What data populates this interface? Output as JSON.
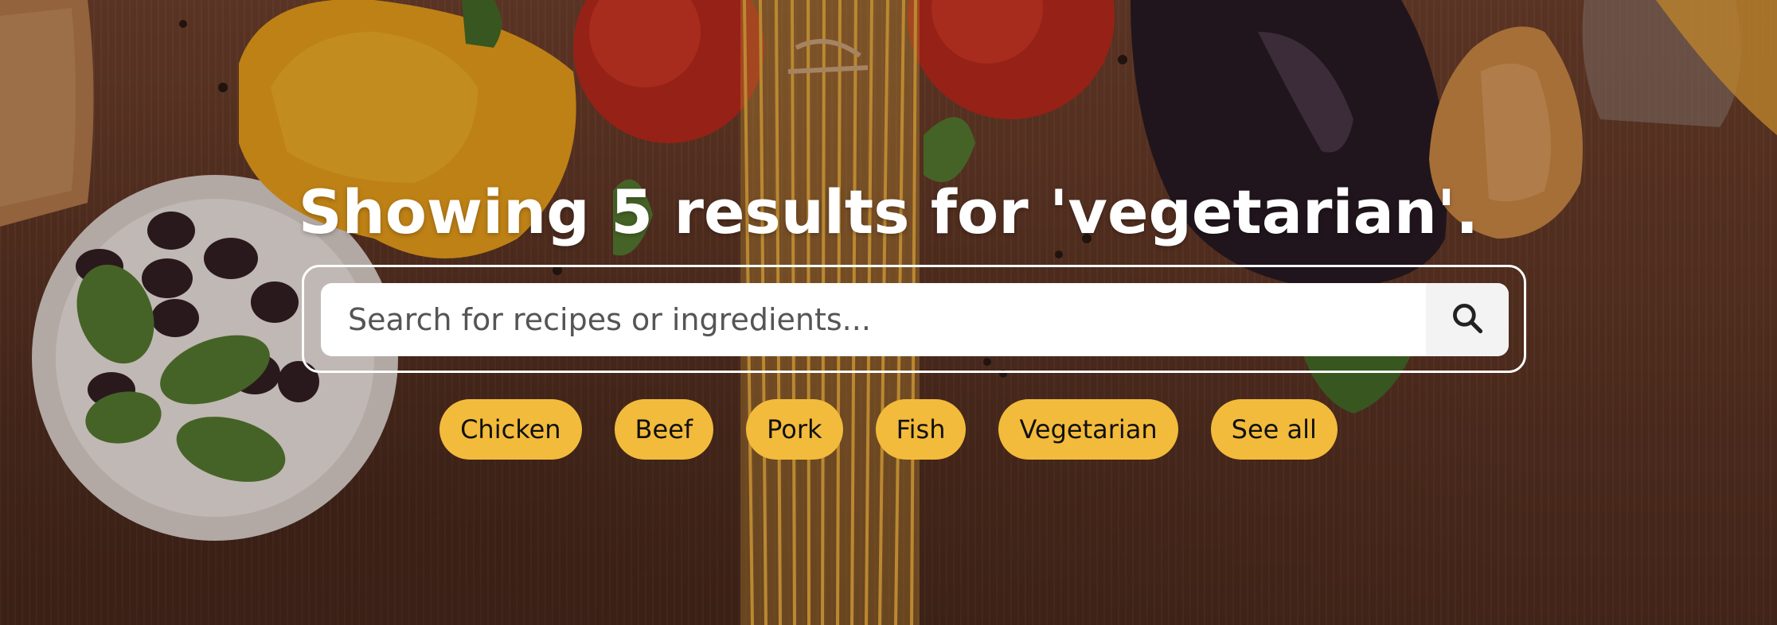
{
  "hero": {
    "heading": "Showing 5 results for 'vegetarian'."
  },
  "search": {
    "placeholder": "Search for recipes or ingredients...",
    "value": ""
  },
  "tags": [
    {
      "label": "Chicken"
    },
    {
      "label": "Beef"
    },
    {
      "label": "Pork"
    },
    {
      "label": "Fish"
    },
    {
      "label": "Vegetarian"
    },
    {
      "label": "See all"
    }
  ],
  "colors": {
    "tag_bg": "#f3bb3b",
    "heading": "#ffffff",
    "background": "#5a3423"
  },
  "icons": {
    "search": "search-icon"
  }
}
